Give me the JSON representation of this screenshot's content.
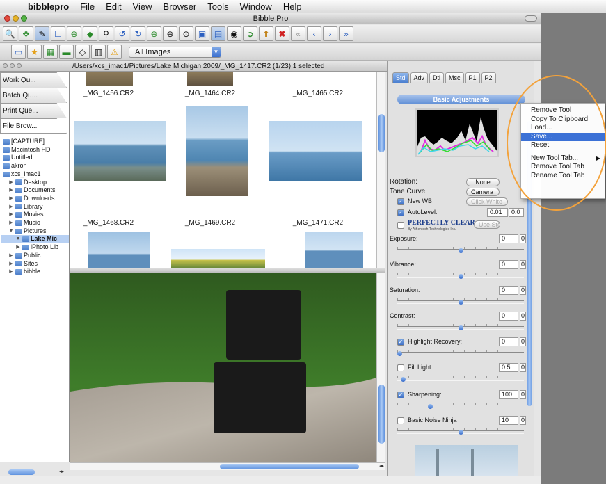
{
  "menubar": {
    "app": "bibblepro",
    "items": [
      "File",
      "Edit",
      "View",
      "Browser",
      "Tools",
      "Window",
      "Help"
    ]
  },
  "window": {
    "title": "Bibble Pro"
  },
  "toolbar": {
    "icons": [
      "zoom-icon",
      "move-icon",
      "eyedropper-icon",
      "crop-icon",
      "zoom-in-icon",
      "retouch-icon",
      "brush-icon",
      "rotate-left-icon",
      "rotate-right-icon",
      "zoom-in-icon",
      "zoom-out-icon",
      "zoom-fit-icon",
      "panel-icon",
      "grid-view-icon",
      "process-icon",
      "export-icon",
      "upload-icon",
      "delete-icon",
      "first-icon",
      "previous-icon",
      "next-icon",
      "last-icon"
    ],
    "filter_value": "All Images"
  },
  "pathbar": {
    "path": "/Users/xcs_imac1/Pictures/Lake Michigan 2009/_MG_1417.CR2 (1/23) 1 selected"
  },
  "sidebar": {
    "tabs": [
      "Work Qu...",
      "Batch Qu...",
      "Print Que...",
      "File Brow..."
    ],
    "tree": [
      {
        "label": "[CAPTURE]",
        "indent": 0,
        "disc": ""
      },
      {
        "label": "Macintosh HD",
        "indent": 0,
        "disc": ""
      },
      {
        "label": "Untitled",
        "indent": 0,
        "disc": ""
      },
      {
        "label": "akron",
        "indent": 0,
        "disc": ""
      },
      {
        "label": "xcs_imac1",
        "indent": 0,
        "disc": ""
      },
      {
        "label": "Desktop",
        "indent": 1,
        "disc": "▶"
      },
      {
        "label": "Documents",
        "indent": 1,
        "disc": "▶"
      },
      {
        "label": "Downloads",
        "indent": 1,
        "disc": "▶"
      },
      {
        "label": "Library",
        "indent": 1,
        "disc": "▶"
      },
      {
        "label": "Movies",
        "indent": 1,
        "disc": "▶"
      },
      {
        "label": "Music",
        "indent": 1,
        "disc": "▶"
      },
      {
        "label": "Pictures",
        "indent": 1,
        "disc": "▼"
      },
      {
        "label": "Lake Mic",
        "indent": 2,
        "disc": "▼"
      },
      {
        "label": "iPhoto Lib",
        "indent": 2,
        "disc": "▶"
      },
      {
        "label": "Public",
        "indent": 1,
        "disc": "▶"
      },
      {
        "label": "Sites",
        "indent": 1,
        "disc": "▶"
      },
      {
        "label": "bibble",
        "indent": 1,
        "disc": "▶"
      }
    ]
  },
  "thumbnails": {
    "row1": [
      "_MG_1456.CR2",
      "_MG_1464.CR2",
      "_MG_1465.CR2"
    ],
    "row2": [
      "_MG_1468.CR2",
      "_MG_1469.CR2",
      "_MG_1471.CR2"
    ]
  },
  "right_panel": {
    "tabs": [
      "Std",
      "Adv",
      "Dtl",
      "Msc",
      "P1",
      "P2"
    ],
    "section": "Basic Adjustments",
    "rotation_label": "Rotation:",
    "rotation_value": "None",
    "tone_curve_label": "Tone Curve:",
    "tone_curve_value": "Camera",
    "new_wb": "New WB",
    "click_white": "Click White",
    "autolevel": "AutoLevel:",
    "autolevel_v1": "0.01",
    "autolevel_v2": "0.0",
    "perfectly_clear": "PERFECTLY CLEAR",
    "perfectly_clear_sub": "By Athentech Technologies Inc.",
    "use_std": "Use Std",
    "sliders": [
      {
        "label": "Exposure:",
        "value": "0",
        "v2": "0",
        "checkbox": false,
        "pos": 0.5
      },
      {
        "label": "Vibrance:",
        "value": "0",
        "v2": "0",
        "checkbox": false,
        "pos": 0.5
      },
      {
        "label": "Saturation:",
        "value": "0",
        "v2": "0",
        "checkbox": false,
        "pos": 0.5
      },
      {
        "label": "Contrast:",
        "value": "0",
        "v2": "0",
        "checkbox": false,
        "pos": 0.5
      },
      {
        "label": "Highlight Recovery:",
        "value": "0",
        "v2": "0",
        "checkbox": true,
        "checked": true,
        "pos": 0.0
      },
      {
        "label": "Fill Light",
        "value": "0.5",
        "v2": "0",
        "checkbox": true,
        "checked": false,
        "pos": 0.03
      },
      {
        "label": "Sharpening:",
        "value": "100",
        "v2": "0",
        "checkbox": true,
        "checked": true,
        "pos": 0.25
      },
      {
        "label": "Basic Noise Ninja",
        "value": "10",
        "v2": "0",
        "checkbox": true,
        "checked": false,
        "pos": 0.5
      }
    ]
  },
  "context_menu": {
    "group1": [
      "Remove Tool",
      "Copy To Clipboard",
      "Load...",
      "Save...",
      "Reset"
    ],
    "highlighted": "Save...",
    "group2": [
      "New Tool Tab...",
      "Remove Tool Tab",
      "Rename Tool Tab"
    ]
  },
  "colors": {
    "accent": "#3b71d6",
    "annotation_circle": "#f3a23b",
    "selection": "#b7d0f3"
  }
}
